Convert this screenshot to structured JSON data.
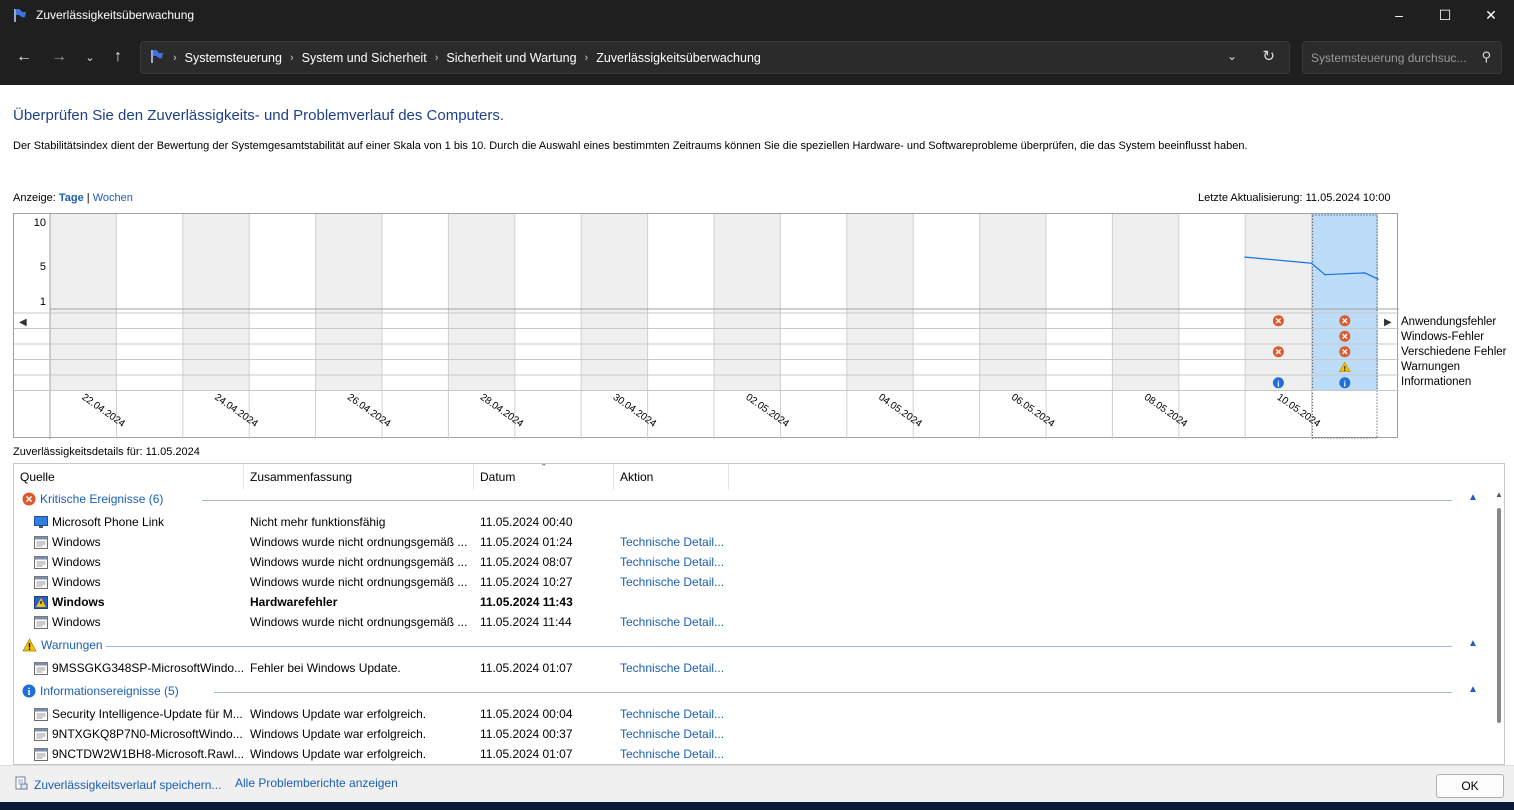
{
  "window": {
    "title": "Zuverlässigkeitsüberwachung"
  },
  "nav": {
    "breadcrumbs": [
      "Systemsteuerung",
      "System und Sicherheit",
      "Sicherheit und Wartung",
      "Zuverlässigkeitsüberwachung"
    ],
    "search_placeholder": "Systemsteuerung durchsuc..."
  },
  "page": {
    "heading": "Überprüfen Sie den Zuverlässigkeits- und Problemverlauf des Computers.",
    "description": "Der Stabilitätsindex dient der Bewertung der Systemgesamtstabilität auf einer Skala von 1 bis 10. Durch die Auswahl eines bestimmten Zeitraums können Sie die speziellen Hardware- und Softwareprobleme überprüfen, die das System beeinflusst haben.",
    "view_label": "Anzeige:",
    "view_days": "Tage",
    "view_sep": "|",
    "view_weeks": "Wochen",
    "last_update": "Letzte Aktualisierung: 11.05.2024 10:00",
    "details_for": "Zuverlässigkeitsdetails für: 11.05.2024"
  },
  "chart_data": {
    "type": "line",
    "y_ticks": [
      "10",
      "5",
      "1"
    ],
    "ylim": [
      1,
      10
    ],
    "date_labels": [
      "22.04.2024",
      "24.04.2024",
      "26.04.2024",
      "28.04.2024",
      "30.04.2024",
      "02.05.2024",
      "04.05.2024",
      "06.05.2024",
      "08.05.2024",
      "10.05.2024"
    ],
    "series": [
      {
        "x": [
          "10.05.2024",
          "11.05.2024",
          "11.05.2024",
          "11.05.2024",
          "11.05.2024"
        ],
        "values": [
          6.0,
          5.3,
          4.0,
          4.2,
          3.5
        ]
      }
    ],
    "event_rows": [
      "Anwendungsfehler",
      "Windows-Fehler",
      "Verschiedene Fehler",
      "Warnungen",
      "Informationen"
    ],
    "events": [
      {
        "date": "10.05.2024",
        "row": "Anwendungsfehler",
        "kind": "error"
      },
      {
        "date": "10.05.2024",
        "row": "Verschiedene Fehler",
        "kind": "error"
      },
      {
        "date": "10.05.2024",
        "row": "Informationen",
        "kind": "info"
      },
      {
        "date": "11.05.2024",
        "row": "Anwendungsfehler",
        "kind": "error"
      },
      {
        "date": "11.05.2024",
        "row": "Windows-Fehler",
        "kind": "error"
      },
      {
        "date": "11.05.2024",
        "row": "Verschiedene Fehler",
        "kind": "error"
      },
      {
        "date": "11.05.2024",
        "row": "Warnungen",
        "kind": "warning"
      },
      {
        "date": "11.05.2024",
        "row": "Informationen",
        "kind": "info"
      }
    ],
    "selected_day": "11.05.2024",
    "colors": {
      "line": "#1a73e8",
      "selected": "#bcdcf7",
      "shade": "#efefef"
    }
  },
  "table": {
    "columns": [
      "Quelle",
      "Zusammenfassung",
      "Datum",
      "Aktion"
    ],
    "groups": [
      {
        "label": "Kritische Ereignisse (6)",
        "icon": "error-icon",
        "rows": [
          {
            "icon": "monitor-icon",
            "source": "Microsoft Phone Link",
            "summary": "Nicht mehr funktionsfähig",
            "date": "11.05.2024 00:40",
            "action": "",
            "bold": false
          },
          {
            "icon": "window-icon",
            "source": "Windows",
            "summary": "Windows wurde nicht ordnungsgemäß ...",
            "date": "11.05.2024 01:24",
            "action": "Technische Detail...",
            "bold": false
          },
          {
            "icon": "window-icon",
            "source": "Windows",
            "summary": "Windows wurde nicht ordnungsgemäß ...",
            "date": "11.05.2024 08:07",
            "action": "Technische Detail...",
            "bold": false
          },
          {
            "icon": "window-icon",
            "source": "Windows",
            "summary": "Windows wurde nicht ordnungsgemäß ...",
            "date": "11.05.2024 10:27",
            "action": "Technische Detail...",
            "bold": false
          },
          {
            "icon": "hardware-icon",
            "source": "Windows",
            "summary": "Hardwarefehler",
            "date": "11.05.2024 11:43",
            "action": "",
            "bold": true
          },
          {
            "icon": "window-icon",
            "source": "Windows",
            "summary": "Windows wurde nicht ordnungsgemäß ...",
            "date": "11.05.2024 11:44",
            "action": "Technische Detail...",
            "bold": false
          }
        ]
      },
      {
        "label": "Warnungen",
        "icon": "warning-icon",
        "rows": [
          {
            "icon": "window-icon",
            "source": "9MSSGKG348SP-MicrosoftWindo...",
            "summary": "Fehler bei Windows Update.",
            "date": "11.05.2024 01:07",
            "action": "Technische Detail...",
            "bold": false
          }
        ]
      },
      {
        "label": "Informationsereignisse (5)",
        "icon": "info-icon",
        "rows": [
          {
            "icon": "window-icon",
            "source": "Security Intelligence-Update für M...",
            "summary": "Windows Update war erfolgreich.",
            "date": "11.05.2024 00:04",
            "action": "Technische Detail...",
            "bold": false
          },
          {
            "icon": "window-icon",
            "source": "9NTXGKQ8P7N0-MicrosoftWindo...",
            "summary": "Windows Update war erfolgreich.",
            "date": "11.05.2024 00:37",
            "action": "Technische Detail...",
            "bold": false
          },
          {
            "icon": "window-icon",
            "source": "9NCTDW2W1BH8-Microsoft.Rawl...",
            "summary": "Windows Update war erfolgreich.",
            "date": "11.05.2024 01:07",
            "action": "Technische Detail...",
            "bold": false
          }
        ]
      }
    ]
  },
  "footer": {
    "save_link": "Zuverlässigkeitsverlauf speichern...",
    "all_reports_link": "Alle Problemberichte anzeigen",
    "ok_label": "OK"
  }
}
